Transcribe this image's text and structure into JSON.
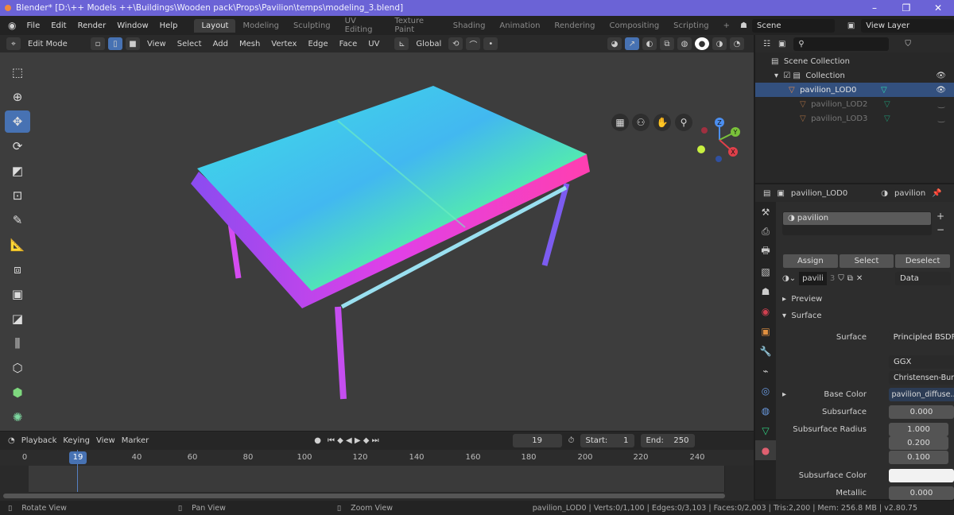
{
  "window": {
    "title": "Blender* [D:\\++ Models ++\\Buildings\\Wooden pack\\Props\\Pavilion\\temps\\modeling_3.blend]",
    "minimize": "–",
    "maximize": "❐",
    "close": "✕"
  },
  "menu": [
    "File",
    "Edit",
    "Render",
    "Window",
    "Help"
  ],
  "workspaces": [
    {
      "label": "Layout",
      "active": true
    },
    {
      "label": "Modeling"
    },
    {
      "label": "Sculpting"
    },
    {
      "label": "UV Editing"
    },
    {
      "label": "Texture Paint"
    },
    {
      "label": "Shading"
    },
    {
      "label": "Animation"
    },
    {
      "label": "Rendering"
    },
    {
      "label": "Compositing"
    },
    {
      "label": "Scripting"
    }
  ],
  "add_workspace": "+",
  "scene": "Scene",
  "view_layer": "View Layer",
  "viewport_header": {
    "mode": "Edit Mode",
    "menus": [
      "View",
      "Select",
      "Add",
      "Mesh",
      "Vertex",
      "Edge",
      "Face",
      "UV"
    ],
    "orientation": "Global"
  },
  "tools": [
    "cursor-select",
    "cursor",
    "move",
    "rotate",
    "scale",
    "transform",
    "annotate",
    "measure",
    "extrude",
    "inset",
    "bevel",
    "loop-cut",
    "knife",
    "poly-build",
    "spin"
  ],
  "gizmo": {
    "x": "X",
    "y": "Y",
    "z": "Z"
  },
  "timeline": {
    "menus": [
      "Playback",
      "Keying",
      "View",
      "Marker"
    ],
    "current_frame": "19",
    "start_label": "Start:",
    "start": "1",
    "end_label": "End:",
    "end": "250",
    "ticks": [
      "0",
      "40",
      "60",
      "80",
      "100",
      "120",
      "140",
      "160",
      "180",
      "200",
      "220",
      "240"
    ]
  },
  "status": {
    "rotate": "Rotate View",
    "pan": "Pan View",
    "zoom": "Zoom View",
    "stats": "pavilion_LOD0 | Verts:0/1,100 | Edges:0/3,103 | Faces:0/2,003 | Tris:2,200 | Mem: 256.8 MB | v2.80.75"
  },
  "outliner": {
    "root": "Scene Collection",
    "collection": "Collection",
    "objects": [
      {
        "name": "pavilion_LOD0",
        "selected": true
      },
      {
        "name": "pavilion_LOD2"
      },
      {
        "name": "pavilion_LOD3"
      }
    ]
  },
  "properties": {
    "object": "pavilion_LOD0",
    "material": "pavilion",
    "slot": "pavilion",
    "assign": "Assign",
    "select": "Select",
    "deselect": "Deselect",
    "mat_name": "pavili",
    "users": "3",
    "link": "Data",
    "preview": "Preview",
    "surface_panel": "Surface",
    "rows": {
      "surface_label": "Surface",
      "surface": "Principled BSDF",
      "distribution": "GGX",
      "sss_method": "Christensen-Burley",
      "base_color_label": "Base Color",
      "base_color": "pavilion_diffuse...",
      "subsurface_label": "Subsurface",
      "subsurface": "0.000",
      "radius_label": "Subsurface Radius",
      "radius": [
        "1.000",
        "0.200",
        "0.100"
      ],
      "sss_color_label": "Subsurface Color",
      "metallic_label": "Metallic",
      "metallic": "0.000"
    }
  }
}
